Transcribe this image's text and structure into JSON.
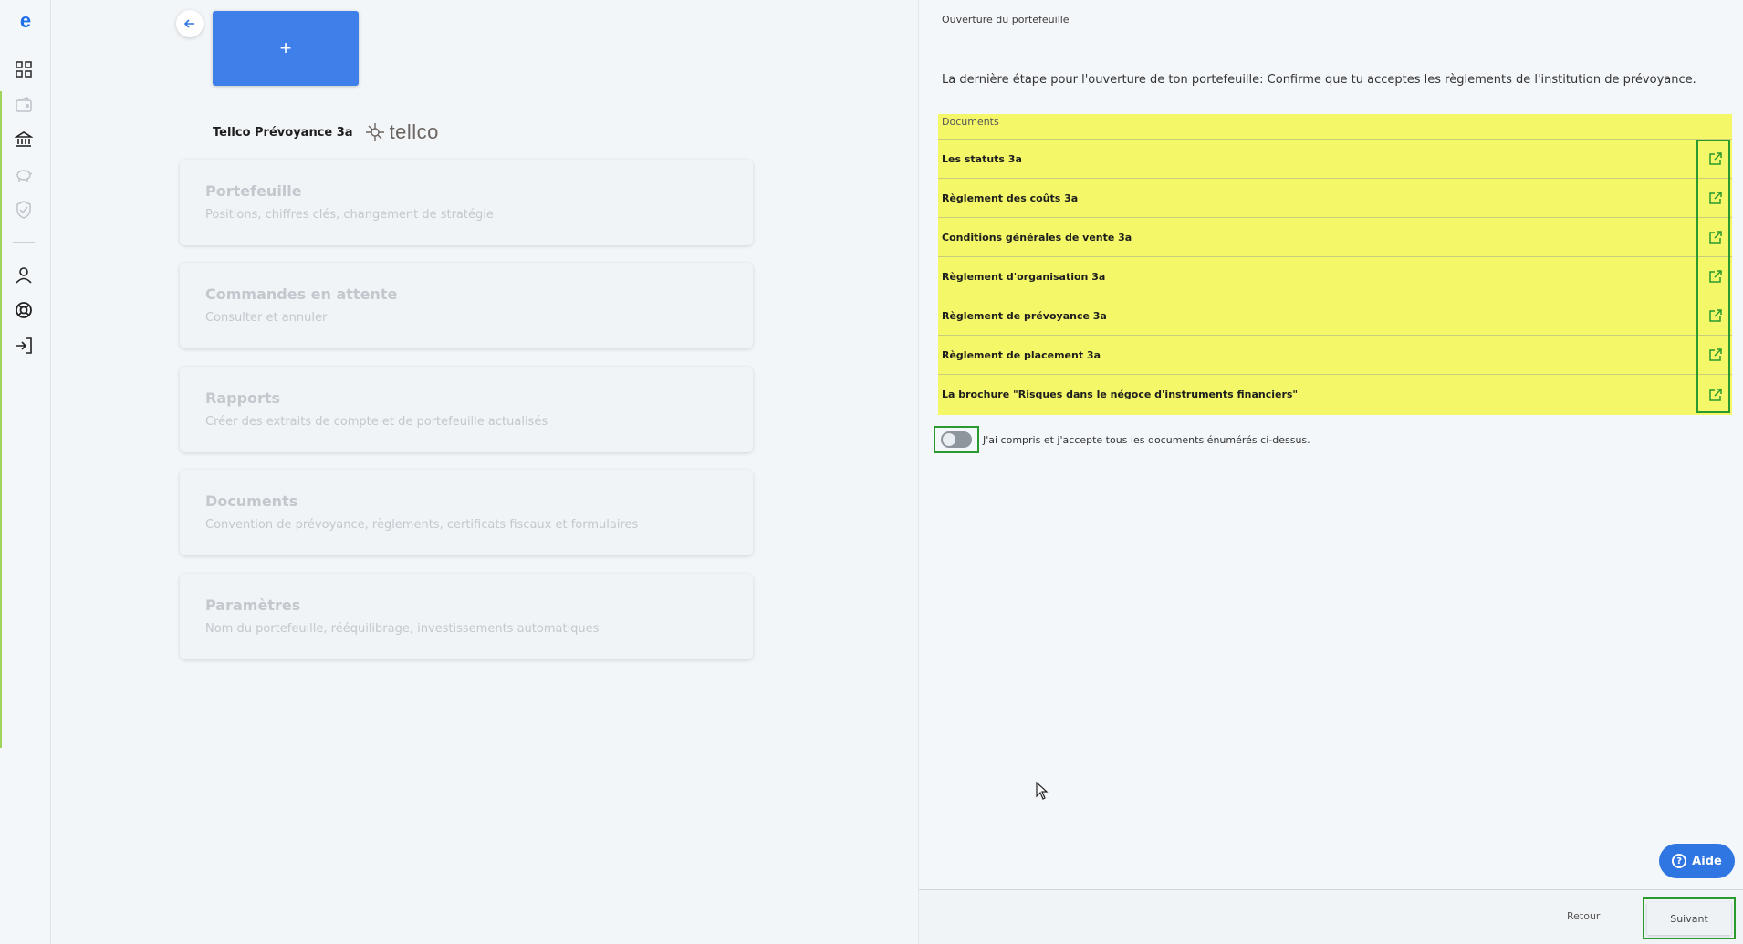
{
  "nav": {
    "logo": "e",
    "icons": [
      "dashboard-icon",
      "wallet-icon",
      "bank-icon",
      "piggy-bank-icon",
      "shield-icon",
      "user-icon",
      "help-lifebuoy-icon",
      "logout-icon"
    ]
  },
  "left": {
    "new_tile_symbol": "+",
    "provider_name": "Tellco Prévoyance 3a",
    "provider_brand": "tellco",
    "cards": [
      {
        "title": "Portefeuille",
        "sub": "Positions, chiffres clés, changement de stratégie"
      },
      {
        "title": "Commandes en attente",
        "sub": "Consulter et annuler"
      },
      {
        "title": "Rapports",
        "sub": "Créer des extraits de compte et de portefeuille actualisés"
      },
      {
        "title": "Documents",
        "sub": "Convention de prévoyance, règlements, certificats fiscaux et formulaires"
      },
      {
        "title": "Paramètres",
        "sub": "Nom du portefeuille, rééquilibrage, investissements automatiques"
      }
    ]
  },
  "panel": {
    "breadcrumb": "Ouverture du portefeuille",
    "lead": "La dernière étape pour l'ouverture de ton portefeuille: Confirme que tu acceptes les règlements de l'institution de prévoyance.",
    "documents_header": "Documents",
    "documents": [
      "Les statuts 3a",
      "Règlement des coûts 3a",
      "Conditions générales de vente 3a",
      "Règlement d'organisation 3a",
      "Règlement de prévoyance 3a",
      "Règlement de placement 3a",
      "La brochure \"Risques dans le négoce d'instruments financiers\""
    ],
    "consent_text": "J'ai compris et j'accepte tous les documents énumérés ci-dessus.",
    "consent_checked": false,
    "help_label": "Aide",
    "back_label": "Retour",
    "next_label": "Suivant"
  },
  "colors": {
    "accent_blue": "#3f7fea",
    "highlight_yellow": "#f3f768",
    "outline_green": "#2a9a2e"
  }
}
